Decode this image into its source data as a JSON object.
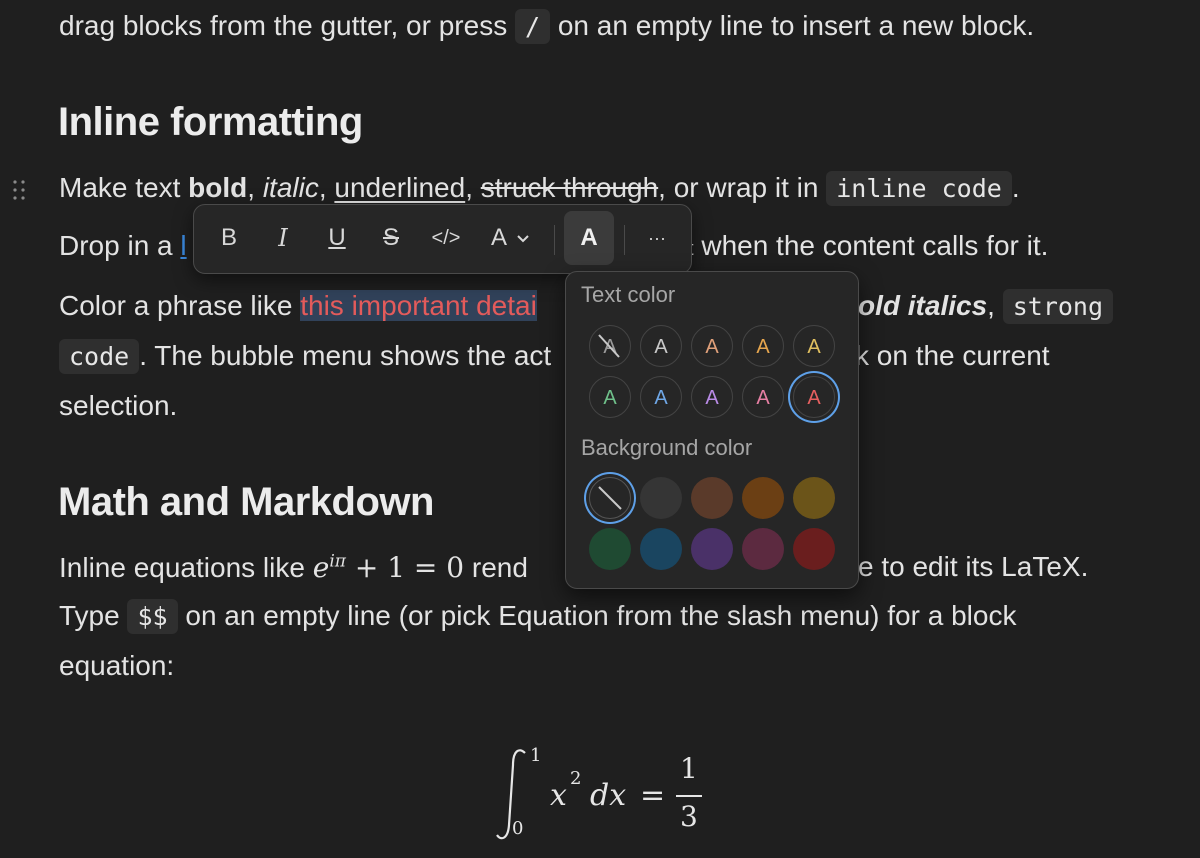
{
  "intro": {
    "before": "drag blocks from the gutter, or press",
    "kbd": "/",
    "after": "on an empty line to insert a new block."
  },
  "h_inline": "Inline formatting",
  "line1": {
    "t1": "Make text ",
    "bold": "bold",
    "t2": ", ",
    "italic": "italic",
    "t3": ", ",
    "underlined": "underlined",
    "t4": ", ",
    "strike": "struck through",
    "t5": ", or wrap it in ",
    "code": "inline code",
    "t6": "."
  },
  "line2": {
    "before": "Drop in a ",
    "link_fragment": "l",
    "hidden_fragment": "t",
    "after": " when the content calls for it."
  },
  "line3": {
    "before": "Color a phrase like ",
    "highlight": "this important detai",
    "bold_italic": "old italics",
    "comma": ", ",
    "code1": "strong"
  },
  "line4": {
    "code2": "code",
    "middle": ". The bubble menu shows the act",
    "end": "k on the current"
  },
  "line5": "selection.",
  "h_math": "Math and Markdown",
  "math_para": {
    "l1_before": "Inline equations like ",
    "l1_after": " rend",
    "l1_end": "e to edit its LaTeX.",
    "l2_before": "Type ",
    "l2_kbd": "$$",
    "l2_after": "on an empty line (or pick Equation from the slash menu) for a block",
    "l3": "equation:"
  },
  "inline_eq": {
    "base": "e",
    "exp": "iπ",
    "rest": "+ 1 = 0"
  },
  "block_eq": {
    "upper": "1",
    "lower": "0",
    "body": "x",
    "power": "2",
    "dx": "dx",
    "eq": "=",
    "num": "1",
    "den": "3"
  },
  "toolbar": {
    "bold": "B",
    "italic": "I",
    "underline": "U",
    "strike": "S",
    "code": "</>",
    "text_style": "A",
    "chevron": "⌄",
    "color": "A",
    "more": "···"
  },
  "color_popover": {
    "text_color_title": "Text color",
    "bg_color_title": "Background color",
    "swatch_letter": "A",
    "text_colors_row1": [
      "#9b9b9b",
      "#c9c9c9",
      "#e0a07a",
      "#e6a64e",
      "#e0c060"
    ],
    "text_colors_row2": [
      "#6fc08a",
      "#6fa7e6",
      "#b98be6",
      "#e67fa3",
      "#e66060"
    ],
    "bg_colors_row1": [
      "none",
      "#353535",
      "#5a3a2a",
      "#6b3f14",
      "#6b5419"
    ],
    "bg_colors_row2": [
      "#1f4a32",
      "#1a4560",
      "#4a3168",
      "#5c2a40",
      "#6a1e1e"
    ]
  },
  "colors": {
    "background": "#1f1f1f",
    "text": "#e3e3e3",
    "accent": "#5ea0e8",
    "link": "#3b8ae0"
  }
}
